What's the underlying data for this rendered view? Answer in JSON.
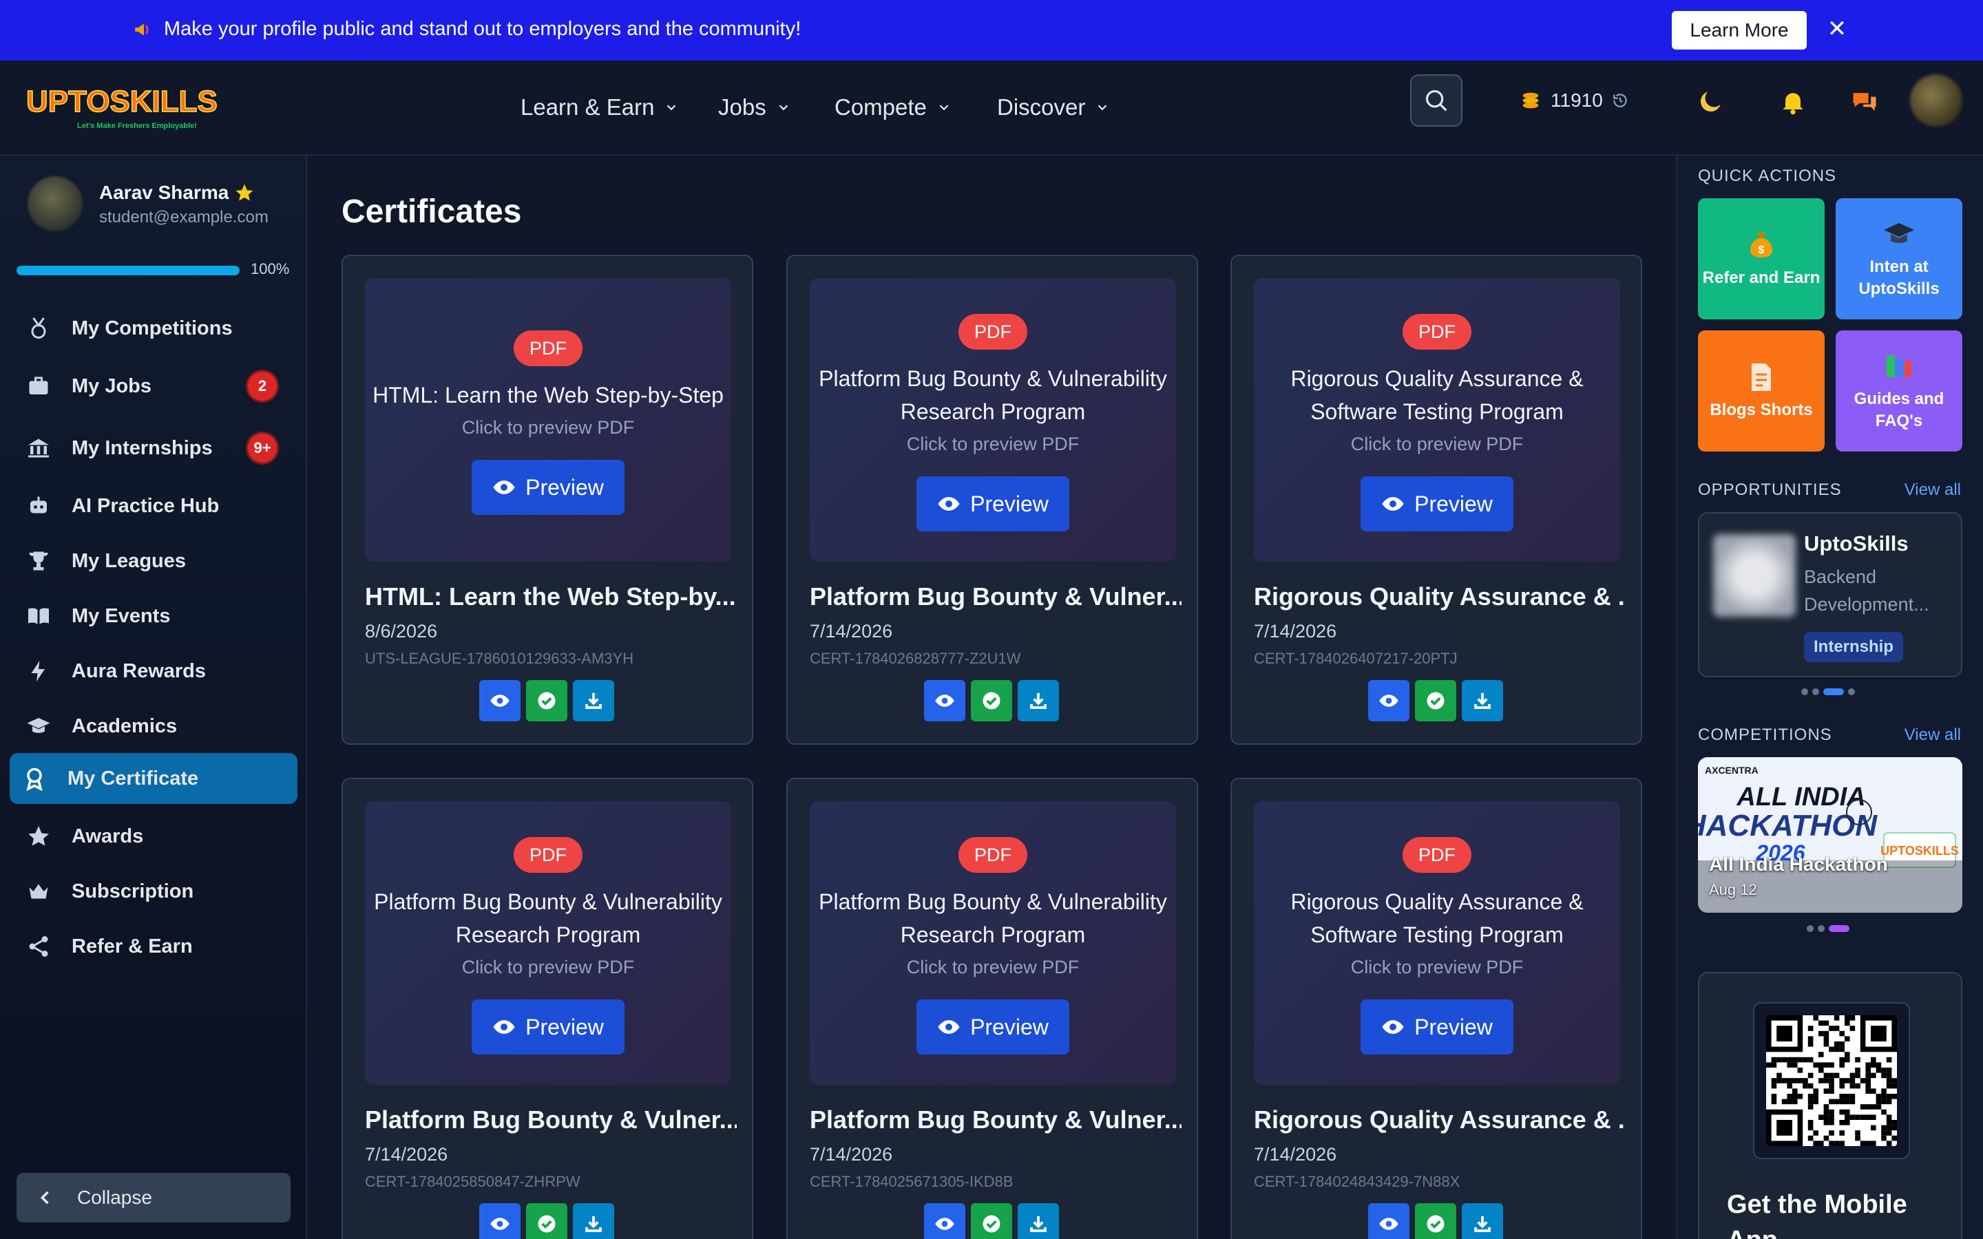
{
  "banner": {
    "message": "Make your profile public and stand out to employers and the community!",
    "learn_more": "Learn More",
    "close": "✕"
  },
  "header": {
    "brand": "UPTOSKILLS",
    "tagline": "Let's Make Freshers Employable!",
    "nav": [
      {
        "label": "Learn & Earn"
      },
      {
        "label": "Jobs"
      },
      {
        "label": "Compete"
      },
      {
        "label": "Discover"
      }
    ],
    "coins": "11910"
  },
  "sidebar": {
    "user_name": "Aarav Sharma",
    "user_email": "student@example.com",
    "profile_progress_pct": 100,
    "profile_progress_label": "100%",
    "items": [
      {
        "label": "My Competitions",
        "icon": "medal-icon"
      },
      {
        "label": "My Jobs",
        "icon": "briefcase-icon",
        "badge": "2"
      },
      {
        "label": "My Internships",
        "icon": "building-icon",
        "badge": "9+"
      },
      {
        "label": "AI Practice Hub",
        "icon": "robot-icon"
      },
      {
        "label": "My Leagues",
        "icon": "trophy-icon"
      },
      {
        "label": "My Events",
        "icon": "book-icon"
      },
      {
        "label": "Aura Rewards",
        "icon": "bolt-icon"
      },
      {
        "label": "Academics",
        "icon": "graduation-cap-icon"
      },
      {
        "label": "My Certificate",
        "icon": "award-icon",
        "active": true
      },
      {
        "label": "Awards",
        "icon": "star-icon"
      },
      {
        "label": "Subscription",
        "icon": "crown-icon"
      },
      {
        "label": "Refer & Earn",
        "icon": "share-icon"
      }
    ],
    "collapse_label": "Collapse"
  },
  "main": {
    "title": "Certificates",
    "pdf_label": "PDF",
    "preview_hint": "Click to preview PDF",
    "preview_button": "Preview",
    "cards": [
      {
        "preview_title": "HTML: Learn the Web Step-by-Step",
        "title": "HTML: Learn the Web Step-by...",
        "date": "8/6/2026",
        "cert_id": "UTS-LEAGUE-1786010129633-AM3YH"
      },
      {
        "preview_title": "Platform Bug Bounty & Vulnerability Research Program",
        "title": "Platform Bug Bounty & Vulner...",
        "date": "7/14/2026",
        "cert_id": "CERT-1784026828777-Z2U1W"
      },
      {
        "preview_title": "Rigorous Quality Assurance & Software Testing Program",
        "title": "Rigorous Quality Assurance & ...",
        "date": "7/14/2026",
        "cert_id": "CERT-1784026407217-20PTJ"
      },
      {
        "preview_title": "Platform Bug Bounty & Vulnerability Research Program",
        "title": "Platform Bug Bounty & Vulner...",
        "date": "7/14/2026",
        "cert_id": "CERT-1784025850847-ZHRPW"
      },
      {
        "preview_title": "Platform Bug Bounty & Vulnerability Research Program",
        "title": "Platform Bug Bounty & Vulner...",
        "date": "7/14/2026",
        "cert_id": "CERT-1784025671305-IKD8B"
      },
      {
        "preview_title": "Rigorous Quality Assurance & Software Testing Program",
        "title": "Rigorous Quality Assurance & ...",
        "date": "7/14/2026",
        "cert_id": "CERT-1784024843429-7N88X"
      }
    ]
  },
  "right_panel": {
    "quick_actions_heading": "QUICK ACTIONS",
    "quick_actions": [
      {
        "label": "Refer and Earn",
        "icon": "money-bag-icon",
        "color": "#10b981"
      },
      {
        "label": "Inten at UptoSkills",
        "icon": "graduation-cap-icon",
        "color": "#3b82f6"
      },
      {
        "label": "Blogs Shorts",
        "icon": "document-icon",
        "color": "#f97316"
      },
      {
        "label": "Guides and FAQ's",
        "icon": "books-icon",
        "color": "#8b5cf6"
      }
    ],
    "opportunities_heading": "OPPORTUNITIES",
    "view_all": "View all",
    "opportunity": {
      "title": "UptoSkills",
      "subtitle": "Backend Development...",
      "tag": "Internship"
    },
    "competitions_heading": "COMPETITIONS",
    "competition": {
      "org": "AXCENTRA",
      "banner_line1": "ALL INDIA",
      "banner_line2": "HACKATHON",
      "banner_year": "2026",
      "name": "All India Hackathon",
      "date": "Aug 12"
    },
    "mobile_title": "Get the Mobile App"
  },
  "colors": {
    "banner": "#1c1ee8",
    "accent_active": "#0b6aa8",
    "preview_button": "#1d4ed8",
    "pdf_badge": "#ef4444",
    "view": "#2563eb",
    "verify": "#16a34a",
    "download": "#0284c7"
  }
}
